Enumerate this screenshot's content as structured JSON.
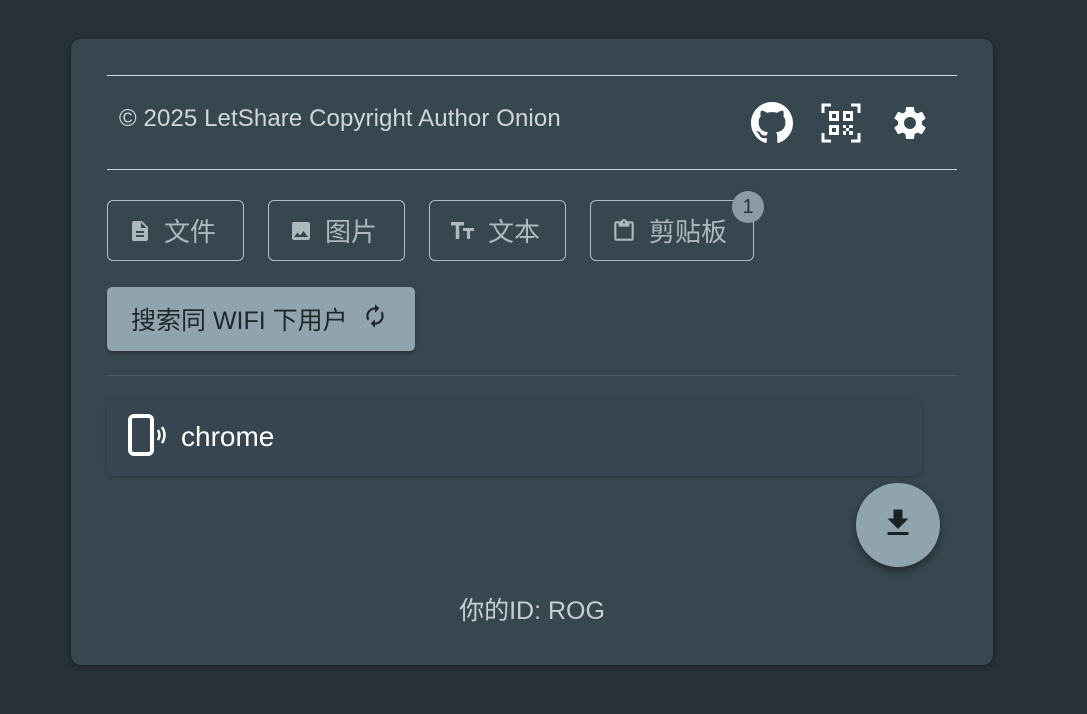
{
  "footer": {
    "copyright": "© 2025 LetShare Copyright Author Onion",
    "icons": [
      "github-icon",
      "qr-code-icon",
      "gear-icon"
    ]
  },
  "tabs": [
    {
      "label": "文件",
      "icon": "file-icon"
    },
    {
      "label": "图片",
      "icon": "image-icon"
    },
    {
      "label": "文本",
      "icon": "text-icon"
    },
    {
      "label": "剪贴板",
      "icon": "clipboard-icon",
      "badge": "1"
    }
  ],
  "search": {
    "label": "搜索同 WIFI 下用户",
    "icon": "refresh-icon"
  },
  "devices": [
    {
      "name": "chrome",
      "icon": "phone-broadcast-icon"
    }
  ],
  "fab": {
    "icon": "download-icon"
  },
  "id_info": {
    "text": "你的ID: ROG"
  },
  "colors": {
    "background": "#263238",
    "card": "#37474f",
    "accent": "#90a4ae"
  }
}
